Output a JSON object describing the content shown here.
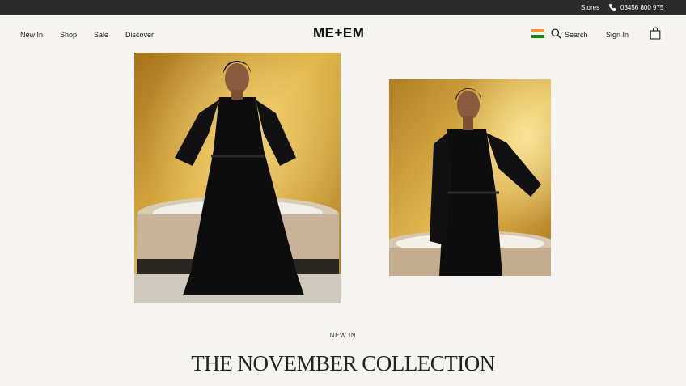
{
  "topbar": {
    "stores_label": "Stores",
    "phone_number": "03456 800 975"
  },
  "nav": {
    "left_links": [
      "New In",
      "Shop",
      "Sale",
      "Discover"
    ],
    "logo": "ME+EM",
    "search_label": "Search",
    "signin_label": "Sign In"
  },
  "hero": {
    "eyebrow": "NEW IN",
    "title": "THE NOVEMBER COLLECTION"
  },
  "colors": {
    "topbar_bg": "#2b2b2b",
    "page_bg": "#f6f4f1",
    "gold_wall": "#c99a2a",
    "dress": "#0d0d0d"
  },
  "icons": [
    "phone-icon",
    "india-flag-icon",
    "search-icon",
    "shopping-bag-icon"
  ]
}
